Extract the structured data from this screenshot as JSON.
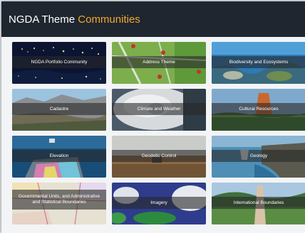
{
  "header": {
    "title_prefix": "NGDA Theme",
    "title_accent": "Communities",
    "background": "#1f2630",
    "accent_color": "#f4a72a"
  },
  "tiles": [
    {
      "label": "NGDA Portfolio Community"
    },
    {
      "label": "Address Theme"
    },
    {
      "label": "Biodiversity and Ecosystems"
    },
    {
      "label": "Cadastre"
    },
    {
      "label": "Climate and Weather"
    },
    {
      "label": "Cultural Resources"
    },
    {
      "label": "Elevation"
    },
    {
      "label": "Geodetic Control"
    },
    {
      "label": "Geology"
    },
    {
      "label": "Governmental Units, and Administrative and Statistical Boundaries"
    },
    {
      "label": "Imagery"
    },
    {
      "label": "International Boundaries"
    }
  ]
}
